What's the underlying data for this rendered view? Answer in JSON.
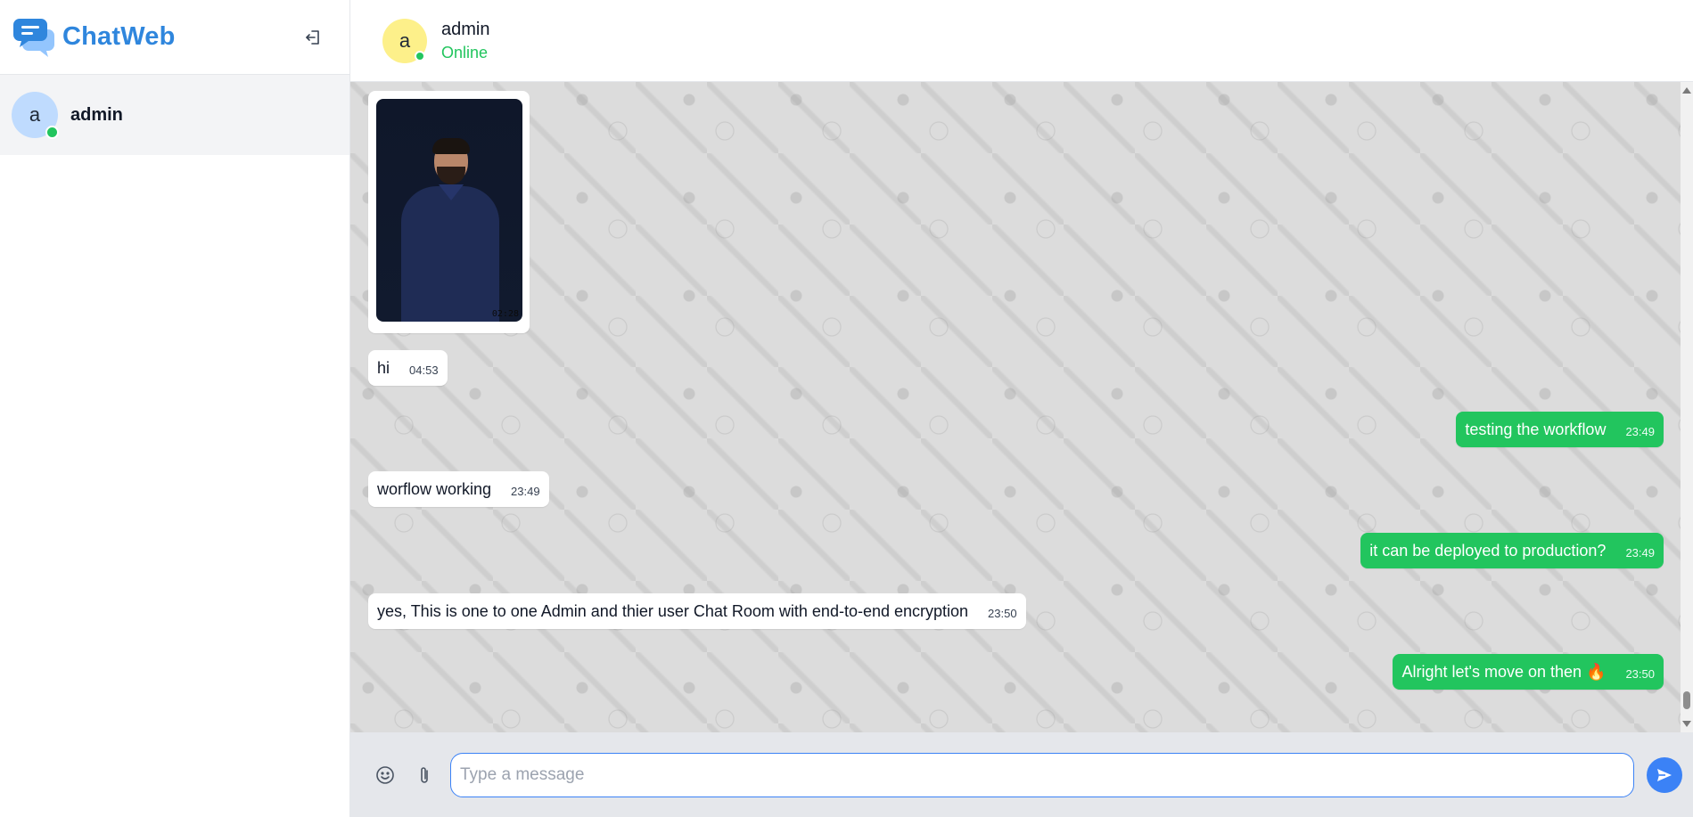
{
  "app": {
    "brand_name": "ChatWeb",
    "accent_color": "#2f86dd",
    "outgoing_color": "#22c55e",
    "logout_icon": "logout-icon"
  },
  "sidebar": {
    "contacts": [
      {
        "initial": "a",
        "name": "admin",
        "online": true
      }
    ]
  },
  "chat_header": {
    "initial": "a",
    "name": "admin",
    "status": "Online"
  },
  "messages": [
    {
      "direction": "in",
      "type": "image",
      "image_stamp": "02:28"
    },
    {
      "direction": "in",
      "text": "hi",
      "time": "04:53"
    },
    {
      "direction": "out",
      "text": "testing the workflow",
      "time": "23:49"
    },
    {
      "direction": "in",
      "text": "worflow working",
      "time": "23:49"
    },
    {
      "direction": "out",
      "text": "it can be deployed to production?",
      "time": "23:49"
    },
    {
      "direction": "in",
      "text": "yes, This is one to one Admin and thier user Chat Room with end-to-end encryption",
      "time": "23:50"
    },
    {
      "direction": "out",
      "text": "Alright let's move on then 🔥",
      "time": "23:50"
    }
  ],
  "composer": {
    "placeholder": "Type a message",
    "value": "",
    "emoji_icon": "smiley-icon",
    "attach_icon": "paperclip-icon",
    "send_icon": "send-icon"
  }
}
